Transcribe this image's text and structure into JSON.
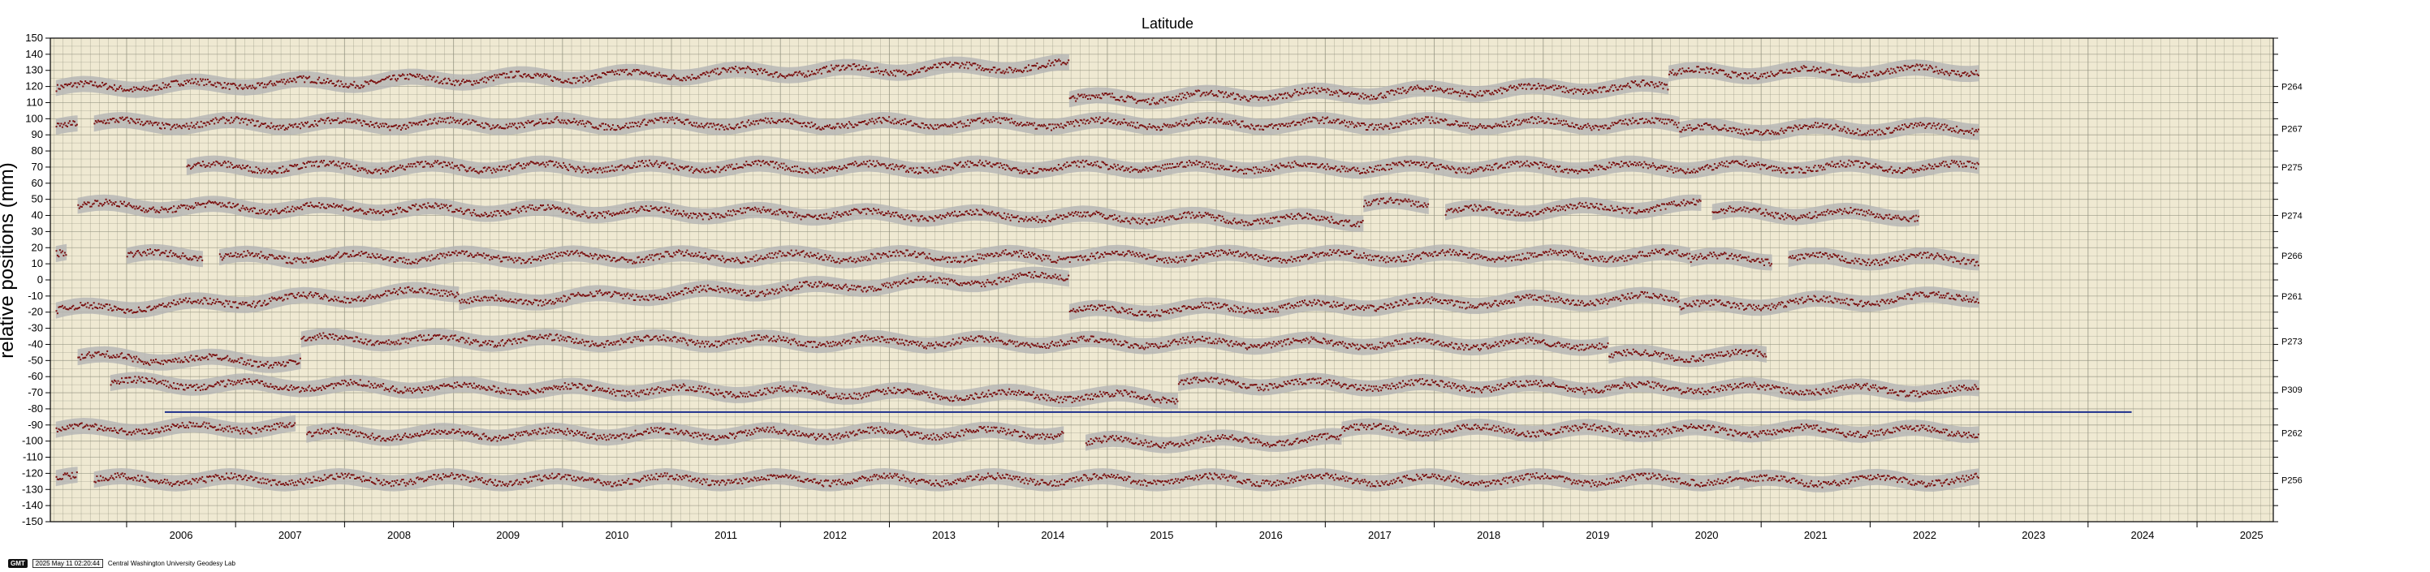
{
  "chart_data": {
    "type": "scatter",
    "title": "Latitude",
    "ylabel": "relative positions (mm)",
    "xlim": [
      2005.3,
      2025.7
    ],
    "ylim": [
      -150,
      150
    ],
    "y_ticks": [
      150,
      140,
      130,
      120,
      110,
      100,
      90,
      80,
      70,
      60,
      50,
      40,
      30,
      20,
      10,
      0,
      -10,
      -20,
      -30,
      -40,
      -50,
      -60,
      -70,
      -80,
      -90,
      -100,
      -110,
      -120,
      -130,
      -140,
      -150
    ],
    "x_ticks": [
      "2006",
      "2007",
      "2008",
      "2009",
      "2010",
      "2011",
      "2012",
      "2013",
      "2014",
      "2015",
      "2016",
      "2017",
      "2018",
      "2019",
      "2020",
      "2021",
      "2022",
      "2023",
      "2024",
      "2025"
    ],
    "grid": true,
    "colors": {
      "points": "#7a1010",
      "band": "#b4b4b4",
      "background": "#efe9d2",
      "grid": "#8c8c7a",
      "reference_line": "#1c2f8c"
    },
    "reference_line": {
      "y": -82,
      "x_start": 2006.35,
      "x_end": 2024.4
    },
    "series": [
      {
        "name": "P264",
        "y": 120,
        "segments": [
          {
            "x": [
              2005.35,
              2014.65
            ],
            "y": [
              119,
              133
            ]
          },
          {
            "x": [
              2014.65,
              2020.15
            ],
            "y": [
              112,
              120
            ]
          },
          {
            "x": [
              2020.15,
              2023.0
            ],
            "y": [
              128,
              130
            ]
          }
        ]
      },
      {
        "name": "P267",
        "y": 94,
        "segments": [
          {
            "x": [
              2005.35,
              2005.55
            ],
            "y": [
              95,
              95
            ]
          },
          {
            "x": [
              2005.7,
              2020.25
            ],
            "y": [
              97,
              97
            ]
          },
          {
            "x": [
              2020.25,
              2023.0
            ],
            "y": [
              93,
              94
            ]
          }
        ]
      },
      {
        "name": "P275",
        "y": 70,
        "segments": [
          {
            "x": [
              2006.55,
              2023.0
            ],
            "y": [
              70,
              70
            ]
          }
        ]
      },
      {
        "name": "P274",
        "y": 40,
        "segments": [
          {
            "x": [
              2005.55,
              2017.35
            ],
            "y": [
              46,
              37
            ]
          },
          {
            "x": [
              2017.35,
              2017.95
            ],
            "y": [
              47,
              47
            ]
          },
          {
            "x": [
              2018.1,
              2020.45
            ],
            "y": [
              42,
              46
            ]
          },
          {
            "x": [
              2020.55,
              2022.45
            ],
            "y": [
              42,
              40
            ]
          }
        ]
      },
      {
        "name": "P266",
        "y": 15,
        "segments": [
          {
            "x": [
              2005.35,
              2005.45
            ],
            "y": [
              16,
              16
            ]
          },
          {
            "x": [
              2006.0,
              2006.7
            ],
            "y": [
              15,
              15
            ]
          },
          {
            "x": [
              2006.85,
              2020.35
            ],
            "y": [
              14,
              15
            ]
          },
          {
            "x": [
              2020.35,
              2021.1
            ],
            "y": [
              13,
              13
            ]
          },
          {
            "x": [
              2021.25,
              2023.0
            ],
            "y": [
              13,
              13
            ]
          }
        ]
      },
      {
        "name": "P261",
        "y": -10,
        "segments": [
          {
            "x": [
              2005.35,
              2009.05
            ],
            "y": [
              -19,
              -7
            ]
          },
          {
            "x": [
              2009.05,
              2014.65
            ],
            "y": [
              -14,
              2
            ]
          },
          {
            "x": [
              2014.65,
              2020.25
            ],
            "y": [
              -20,
              -11
            ]
          },
          {
            "x": [
              2020.25,
              2023.0
            ],
            "y": [
              -17,
              -10
            ]
          }
        ]
      },
      {
        "name": "P273",
        "y": -38,
        "segments": [
          {
            "x": [
              2005.55,
              2007.6
            ],
            "y": [
              -48,
              -51
            ]
          },
          {
            "x": [
              2007.6,
              2019.6
            ],
            "y": [
              -37,
              -40
            ]
          },
          {
            "x": [
              2019.6,
              2021.05
            ],
            "y": [
              -47,
              -47
            ]
          }
        ]
      },
      {
        "name": "P309",
        "y": -68,
        "segments": [
          {
            "x": [
              2005.85,
              2015.65
            ],
            "y": [
              -64,
              -73
            ]
          },
          {
            "x": [
              2015.65,
              2023.0
            ],
            "y": [
              -64,
              -69
            ]
          }
        ]
      },
      {
        "name": "P262",
        "y": -95,
        "segments": [
          {
            "x": [
              2005.35,
              2007.55
            ],
            "y": [
              -93,
              -91
            ]
          },
          {
            "x": [
              2007.65,
              2014.6
            ],
            "y": [
              -96,
              -95
            ]
          },
          {
            "x": [
              2014.8,
              2017.15
            ],
            "y": [
              -101,
              -99
            ]
          },
          {
            "x": [
              2017.15,
              2023.0
            ],
            "y": [
              -93,
              -94
            ]
          }
        ]
      },
      {
        "name": "P256",
        "y": -124,
        "segments": [
          {
            "x": [
              2005.35,
              2005.55
            ],
            "y": [
              -123,
              -123
            ]
          },
          {
            "x": [
              2005.7,
              2020.8
            ],
            "y": [
              -124,
              -124
            ]
          },
          {
            "x": [
              2020.8,
              2023.0
            ],
            "y": [
              -125,
              -124
            ]
          }
        ]
      }
    ]
  },
  "footer": {
    "logo": "GMT",
    "timestamp": "2025 May 11 02:20:44",
    "credit": "Central Washington University Geodesy Lab"
  }
}
